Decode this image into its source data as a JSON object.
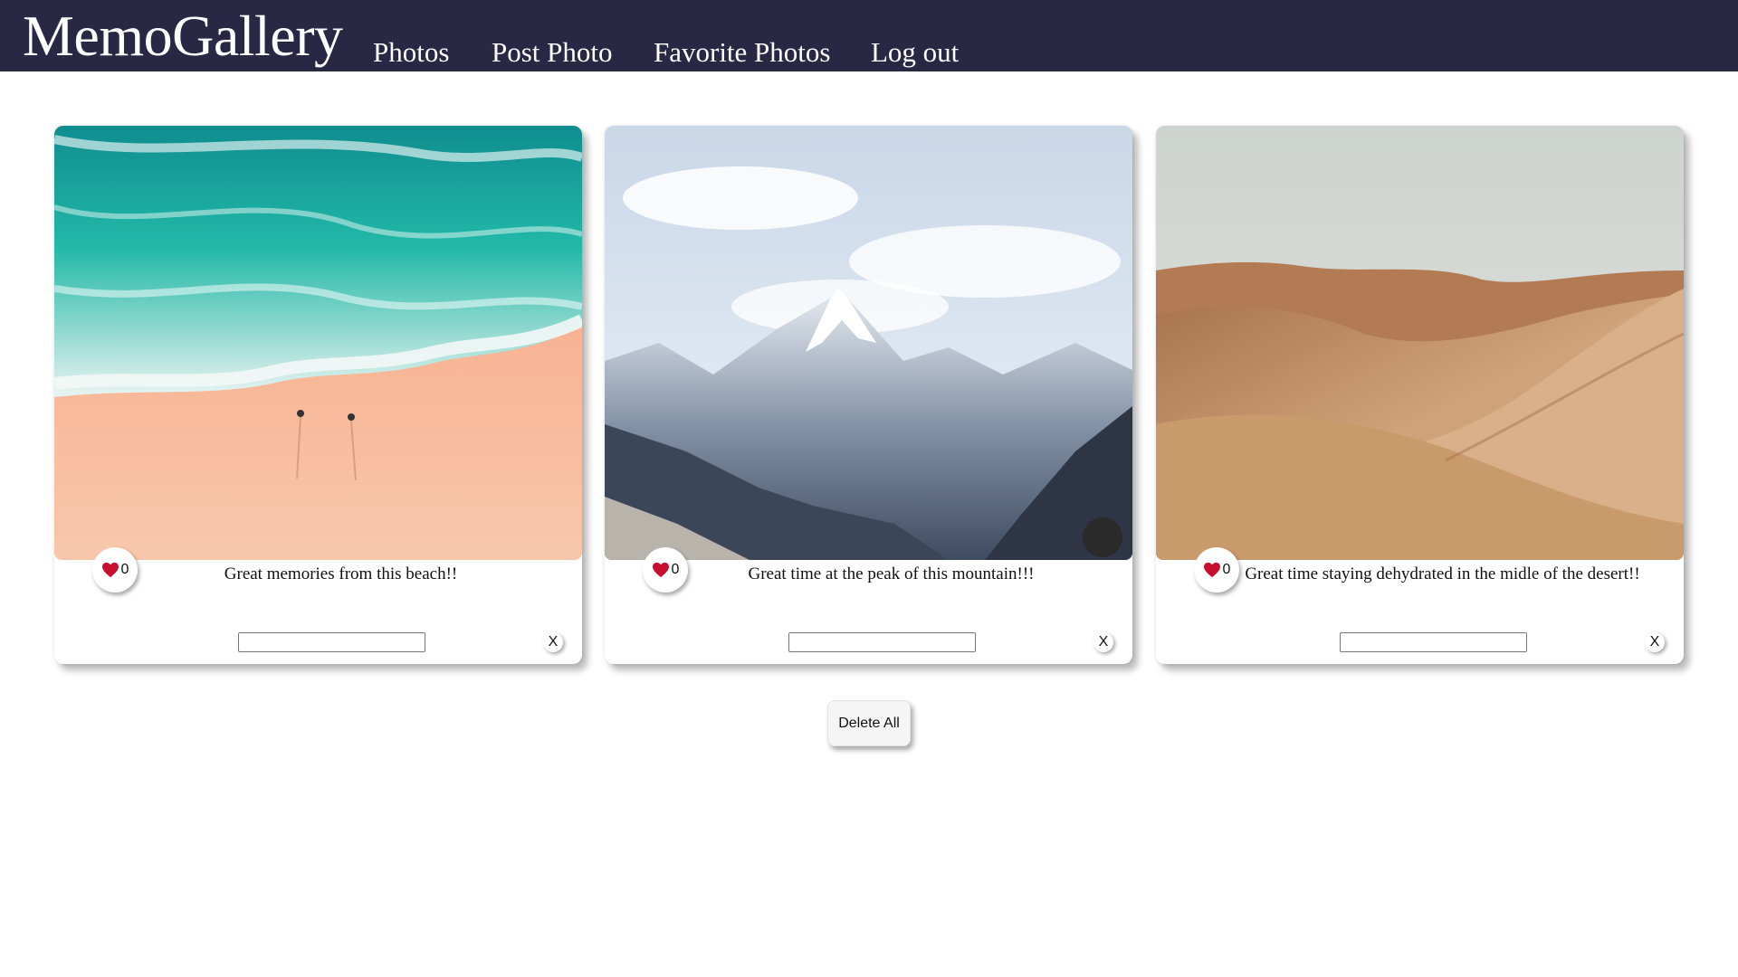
{
  "navbar": {
    "brand": "MemoGallery",
    "links": [
      "Photos",
      "Post Photo",
      "Favorite Photos",
      "Log out"
    ]
  },
  "cards": [
    {
      "likes": "0",
      "caption": "Great memories from this beach!!",
      "comment_value": ""
    },
    {
      "likes": "0",
      "caption": "Great time at the peak of this mountain!!!",
      "comment_value": ""
    },
    {
      "likes": "0",
      "caption": "Great time staying dehydrated in the midle of the desert!!",
      "comment_value": ""
    }
  ],
  "close_label": "X",
  "delete_all_label": "Delete All",
  "icons": {
    "like": "heart-icon"
  },
  "colors": {
    "navbar": "#282744",
    "heart": "#c8102e"
  }
}
